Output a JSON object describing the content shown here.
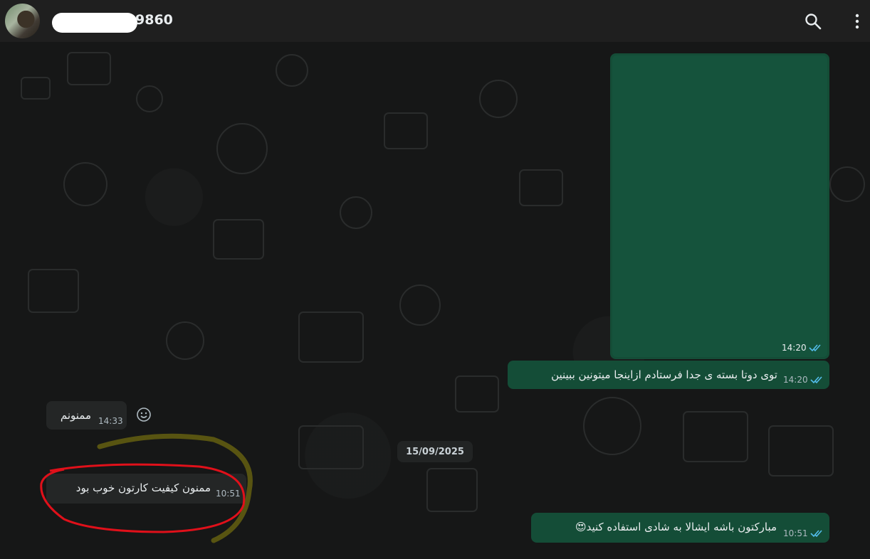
{
  "header": {
    "contact_name": "9860",
    "search_icon": "search-icon",
    "menu_icon": "more-vert-icon"
  },
  "messages": [
    {
      "direction": "out",
      "type": "image",
      "time": "14:20",
      "status": "read"
    },
    {
      "direction": "out",
      "text": "توی دوتا بسته ی جدا فرستادم ازاینجا میتونین ببینین",
      "time": "14:20",
      "status": "read"
    },
    {
      "direction": "in",
      "text": "ممنونم",
      "time": "14:33"
    },
    {
      "direction": "in",
      "text": "ممنون کیفیت کارتون خوب بود",
      "time": "10:51"
    },
    {
      "direction": "out",
      "text": "مبارکتون باشه ایشالا به شادی استفاده کنید",
      "emoji": "😍",
      "time": "10:51",
      "status": "read"
    }
  ],
  "date_divider": "15/09/2025",
  "colors": {
    "outgoing_bubble": "#144d37",
    "incoming_bubble": "#242626",
    "read_tick": "#53bdeb",
    "annotation_red": "#e0101a",
    "annotation_yellow": "#6f6a10"
  }
}
